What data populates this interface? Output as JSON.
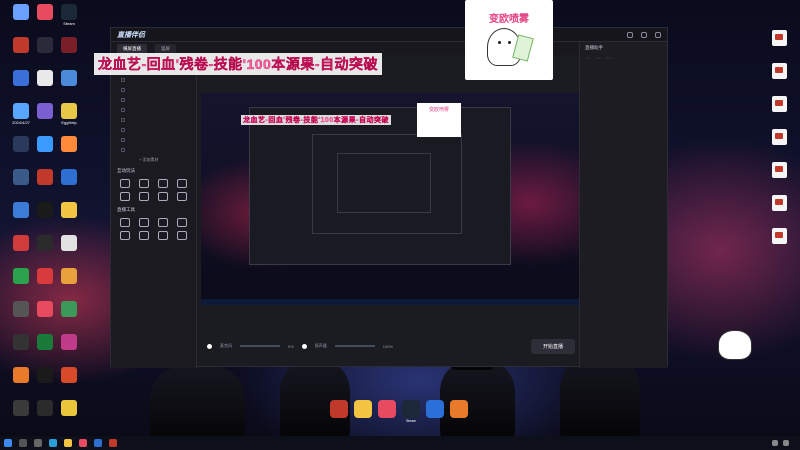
{
  "overlay": {
    "title": "龙血艺-回血'残卷-技能'100本源果-自动突破",
    "badge_text": "变欧喷雾"
  },
  "desktop": {
    "left_icons": [
      {
        "label": "",
        "color": "#6aa0ff"
      },
      {
        "label": "",
        "color": "#e84a5f"
      },
      {
        "label": "Steam",
        "color": "#1b2838"
      },
      {
        "label": "",
        "color": "#c0392b"
      },
      {
        "label": "",
        "color": "#2a2a3a"
      },
      {
        "label": "",
        "color": "#7a1f2a"
      },
      {
        "label": "",
        "color": "#3a6fd8"
      },
      {
        "label": "",
        "color": "#e9e9e9"
      },
      {
        "label": "",
        "color": "#4a8ad8"
      },
      {
        "label": "2024/4/27",
        "color": "#58a6ff"
      },
      {
        "label": "",
        "color": "#7a5fd0"
      },
      {
        "label": "EggHelp",
        "color": "#e8c847"
      },
      {
        "label": "",
        "color": "#2a3a5a"
      },
      {
        "label": "",
        "color": "#3b9aff"
      },
      {
        "label": "",
        "color": "#ff8a3a"
      },
      {
        "label": "",
        "color": "#3a5a8a"
      },
      {
        "label": "",
        "color": "#c0392b"
      },
      {
        "label": "",
        "color": "#2f6fd1"
      },
      {
        "label": "",
        "color": "#3b7cd8"
      },
      {
        "label": "",
        "color": "#1a1a1a"
      },
      {
        "label": "",
        "color": "#f4c542"
      },
      {
        "label": "",
        "color": "#d13b3b"
      },
      {
        "label": "",
        "color": "#2b2b2b"
      },
      {
        "label": "",
        "color": "#e2e2e2"
      },
      {
        "label": "",
        "color": "#2ba24c"
      },
      {
        "label": "",
        "color": "#d83b3b"
      },
      {
        "label": "",
        "color": "#e8a13b"
      },
      {
        "label": "",
        "color": "#555"
      },
      {
        "label": "",
        "color": "#e84a5f"
      },
      {
        "label": "",
        "color": "#3b9a5a"
      },
      {
        "label": "",
        "color": "#333"
      },
      {
        "label": "",
        "color": "#1a7a3a"
      },
      {
        "label": "",
        "color": "#c03b8a"
      },
      {
        "label": "",
        "color": "#e87a2a"
      },
      {
        "label": "",
        "color": "#1a1a1a"
      },
      {
        "label": "",
        "color": "#d84a2a"
      },
      {
        "label": "",
        "color": "#3a3a3a"
      },
      {
        "label": "",
        "color": "#2b2b2b"
      },
      {
        "label": "",
        "color": "#e8c83a"
      }
    ],
    "right_icons": [
      {
        "label": ""
      },
      {
        "label": ""
      },
      {
        "label": ""
      },
      {
        "label": ""
      },
      {
        "label": ""
      },
      {
        "label": ""
      },
      {
        "label": ""
      }
    ]
  },
  "app": {
    "logo": "直播伴侣",
    "version": "",
    "tabs": [
      "横屏直播",
      "竖屏"
    ],
    "top_hint": "",
    "left": {
      "scene_rows": [
        "",
        "",
        "",
        "",
        "",
        "",
        "",
        "",
        "",
        ""
      ],
      "section_interactive": "互动玩法",
      "interactive_tools": [
        "",
        "",
        "",
        "",
        "",
        "",
        "",
        ""
      ],
      "section_tools": "直播工具",
      "tools": [
        "",
        "",
        "",
        "",
        "",
        "",
        "",
        ""
      ],
      "add_scene": "+ 添加素材",
      "footer": ""
    },
    "bottom": {
      "mic_label": "麦克风",
      "mic_value": "0%",
      "spk_label": "扬声器",
      "spk_value": "100%",
      "go_live": "开始直播"
    },
    "right": {
      "header": "直播助手",
      "header_right": "",
      "tabs": [
        "",
        "",
        ""
      ],
      "text_1": "",
      "text_2": "",
      "highlight": "",
      "text_3": ""
    }
  },
  "dock": [
    {
      "label": "",
      "color": "#c0392b"
    },
    {
      "label": "",
      "color": "#f4c542"
    },
    {
      "label": "",
      "color": "#e84a5f"
    },
    {
      "label": "Steam",
      "color": "#1b2838"
    },
    {
      "label": "",
      "color": "#2b6fd8"
    },
    {
      "label": "",
      "color": "#e87a2a"
    }
  ],
  "taskbar": {
    "time": "",
    "date": "",
    "lang": ""
  }
}
